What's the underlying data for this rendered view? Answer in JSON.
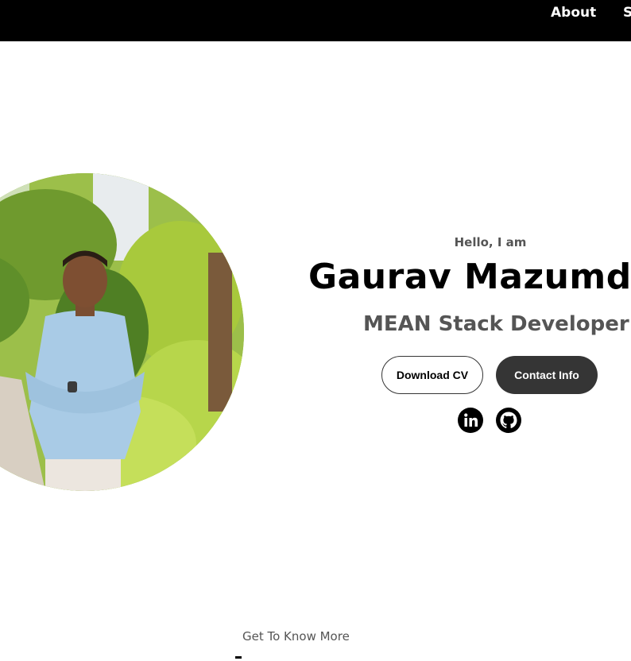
{
  "nav": {
    "links": [
      "About",
      "S"
    ]
  },
  "profile": {
    "greeting": "Hello, I am",
    "name": "Gaurav Mazumd",
    "title": "MEAN Stack Developer",
    "photo_alt": "Gaurav Mazumder profile picture"
  },
  "buttons": {
    "download": "Download CV",
    "contact": "Contact Info"
  },
  "socials": [
    {
      "icon": "linkedin-icon"
    },
    {
      "icon": "github-icon"
    }
  ],
  "about_section": {
    "subtitle": "Get To Know More"
  },
  "colors": {
    "nav_bg": "#000000",
    "text_dark": "#000000",
    "text_muted": "#555555",
    "button_dark": "#353535"
  }
}
